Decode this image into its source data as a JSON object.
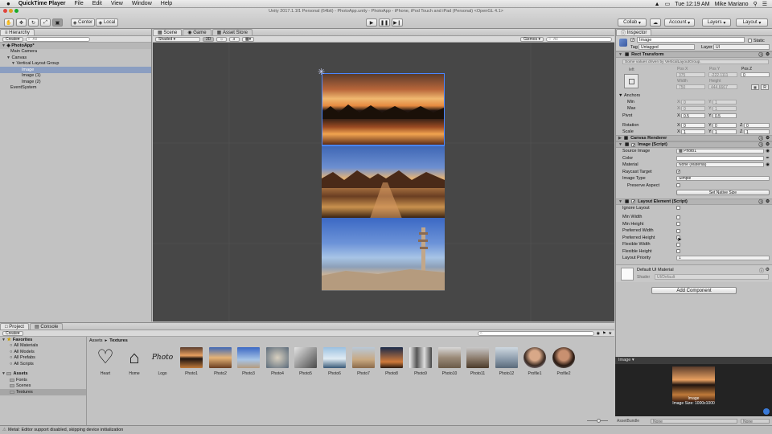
{
  "menubar": {
    "app_name": "QuickTime Player",
    "items": [
      "File",
      "Edit",
      "View",
      "Window",
      "Help"
    ],
    "clock": "Tue 12:19 AM",
    "user": "Mike Mariano"
  },
  "window_title": "Unity 2017.1.1f1 Personal (64bit) - PhotoApp.unity - PhotoApp - iPhone, iPod Touch and iPad (Personal) <OpenGL 4.1>",
  "toolbar": {
    "center_label": "Center",
    "local_label": "Local",
    "collab_label": "Collab",
    "account_label": "Account",
    "layers_label": "Layers",
    "layout_label": "Layout"
  },
  "hierarchy": {
    "tab": "Hierarchy",
    "create": "Create",
    "search_placeholder": "All",
    "scene_name": "PhotoApp*",
    "items": [
      {
        "label": "Main Camera",
        "indent": 1
      },
      {
        "label": "Canvas",
        "indent": 1
      },
      {
        "label": "Vertical Layout Group",
        "indent": 2
      },
      {
        "label": "Image",
        "indent": 3,
        "selected": true
      },
      {
        "label": "Image (1)",
        "indent": 3
      },
      {
        "label": "Image (2)",
        "indent": 3
      },
      {
        "label": "EventSystem",
        "indent": 1
      }
    ]
  },
  "scene": {
    "tabs": [
      "Scene",
      "Game",
      "Asset Store"
    ],
    "shading": "Shaded",
    "mode": "2D",
    "gizmos": "Gizmos",
    "search_placeholder": "All"
  },
  "inspector": {
    "tab": "Inspector",
    "object_name": "Image",
    "static_label": "Static",
    "tag_label": "Tag",
    "tag_value": "Untagged",
    "layer_label": "Layer",
    "layer_value": "UI",
    "rect_transform": {
      "title": "Rect Transform",
      "note": "Some values driven by VerticalLayoutGroup.",
      "anchor_preset": "left",
      "pos_x_label": "Pos X",
      "pos_x": "375",
      "pos_y_label": "Pos Y",
      "pos_y": "-222.1111",
      "pos_z_label": "Pos Z",
      "pos_z": "0",
      "width_label": "Width",
      "width": "750",
      "height_label": "Height",
      "height": "444.6667",
      "anchors_label": "Anchors",
      "min_label": "Min",
      "min_x": "0",
      "min_y": "1",
      "max_label": "Max",
      "max_x": "0",
      "max_y": "1",
      "pivot_label": "Pivot",
      "pivot_x": "0.5",
      "pivot_y": "0.5",
      "rotation_label": "Rotation",
      "rot_x": "0",
      "rot_y": "0",
      "rot_z": "0",
      "scale_label": "Scale",
      "scale_x": "1",
      "scale_y": "1",
      "scale_z": "1"
    },
    "canvas_renderer": "Canvas Renderer",
    "image_script": {
      "title": "Image (Script)",
      "source_image_label": "Source Image",
      "source_image": "Photo1",
      "color_label": "Color",
      "material_label": "Material",
      "material": "None (Material)",
      "raycast_label": "Raycast Target",
      "image_type_label": "Image Type",
      "image_type": "Simple",
      "preserve_label": "Preserve Aspect",
      "native_size_button": "Set Native Size"
    },
    "layout_element": {
      "title": "Layout Element (Script)",
      "fields": [
        "Ignore Layout",
        "Min Width",
        "Min Height",
        "Preferred Width",
        "Preferred Height",
        "Flexible Width",
        "Flexible Height"
      ],
      "priority_label": "Layout Priority",
      "priority": "1"
    },
    "material": {
      "name": "Default UI Material",
      "shader_label": "Shader",
      "shader": "UI/Default"
    },
    "add_component": "Add Component"
  },
  "project": {
    "tabs": [
      "Project",
      "Console"
    ],
    "create": "Create",
    "favorites_label": "Favorites",
    "favorites": [
      "All Materials",
      "All Models",
      "All Prefabs",
      "All Scripts"
    ],
    "assets_label": "Assets",
    "folders": [
      "Fonts",
      "Scenes",
      "Textures"
    ],
    "breadcrumb_root": "Assets",
    "breadcrumb_folder": "Textures",
    "assets": [
      "Heart",
      "Home",
      "Logo",
      "Photo1",
      "Photo2",
      "Photo3",
      "Photo4",
      "Photo5",
      "Photo6",
      "Photo7",
      "Photo8",
      "Photo9",
      "Photo10",
      "Photo11",
      "Photo12",
      "Profile1",
      "Profile2"
    ]
  },
  "preview": {
    "header": "Image",
    "caption": "Image",
    "size_text": "Image Size: 1000x1000",
    "assetbundle_label": "AssetBundle",
    "assetbundle_value": "None",
    "variant_value": "None"
  },
  "status": "Metal: Editor support disabled, skipping device initialization",
  "colors": {
    "selection": "#8b9ec1",
    "scene_bg": "#474747",
    "panel": "#c2c2c2"
  }
}
